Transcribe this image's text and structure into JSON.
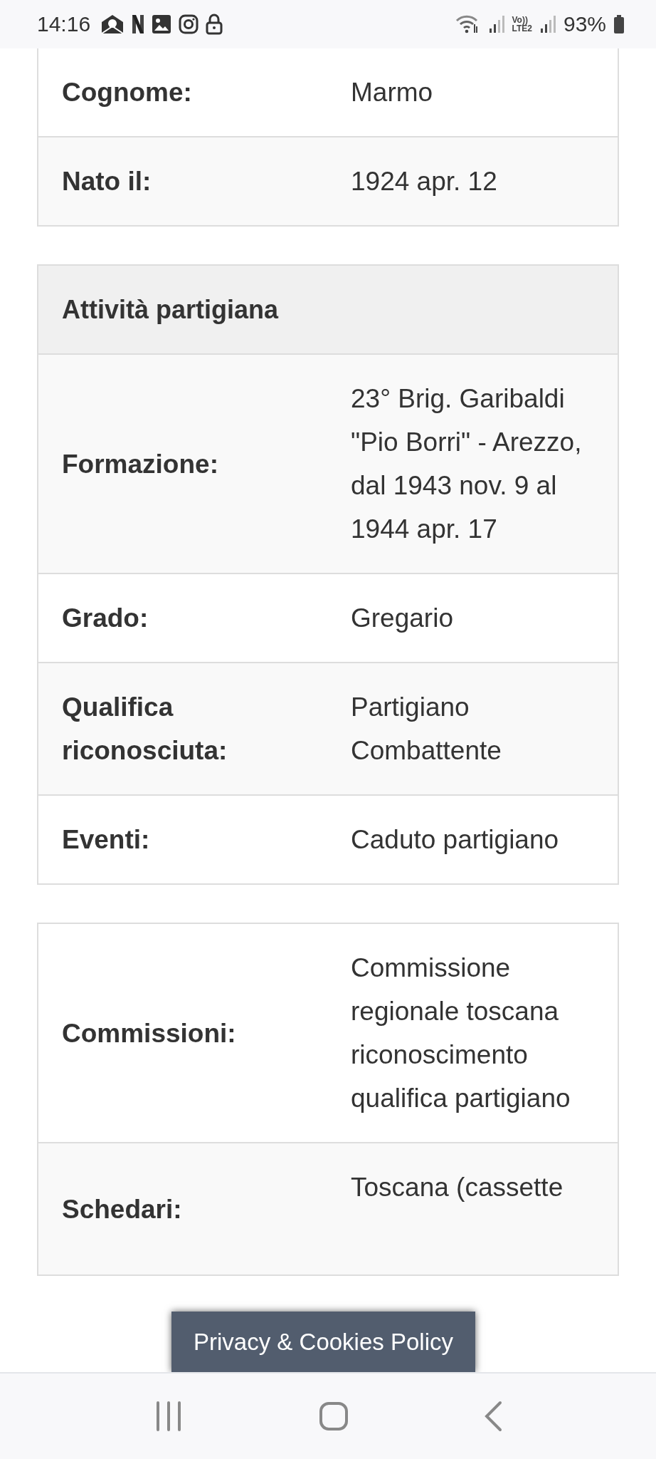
{
  "status_bar": {
    "time": "14:16",
    "volte": "Vo))",
    "network": "LTE2",
    "battery": "93%"
  },
  "tables": [
    {
      "rows": [
        {
          "label": "Cognome:",
          "value": "Marmo"
        },
        {
          "label": "Nato il:",
          "value": "1924 apr. 12"
        }
      ],
      "cut_top": true
    },
    {
      "header": "Attività partigiana",
      "rows": [
        {
          "label": "Formazione:",
          "value": "23° Brig. Garibaldi \"Pio Borri\" - Arezzo, dal 1943 nov. 9 al 1944 apr. 17"
        },
        {
          "label": "Grado:",
          "value": "Gregario"
        },
        {
          "label": "Qualifica riconosciuta:",
          "value": "Partigiano Combattente"
        },
        {
          "label": "Eventi:",
          "value": "Caduto partigiano"
        }
      ]
    },
    {
      "rows": [
        {
          "label": "Commissioni:",
          "value": "Commissione regionale toscana riconoscimento qualifica partigiano"
        },
        {
          "label": "Schedari:",
          "value": "Toscana (cassette",
          "covered": true
        }
      ]
    }
  ],
  "privacy_button": "Privacy & Cookies Policy"
}
